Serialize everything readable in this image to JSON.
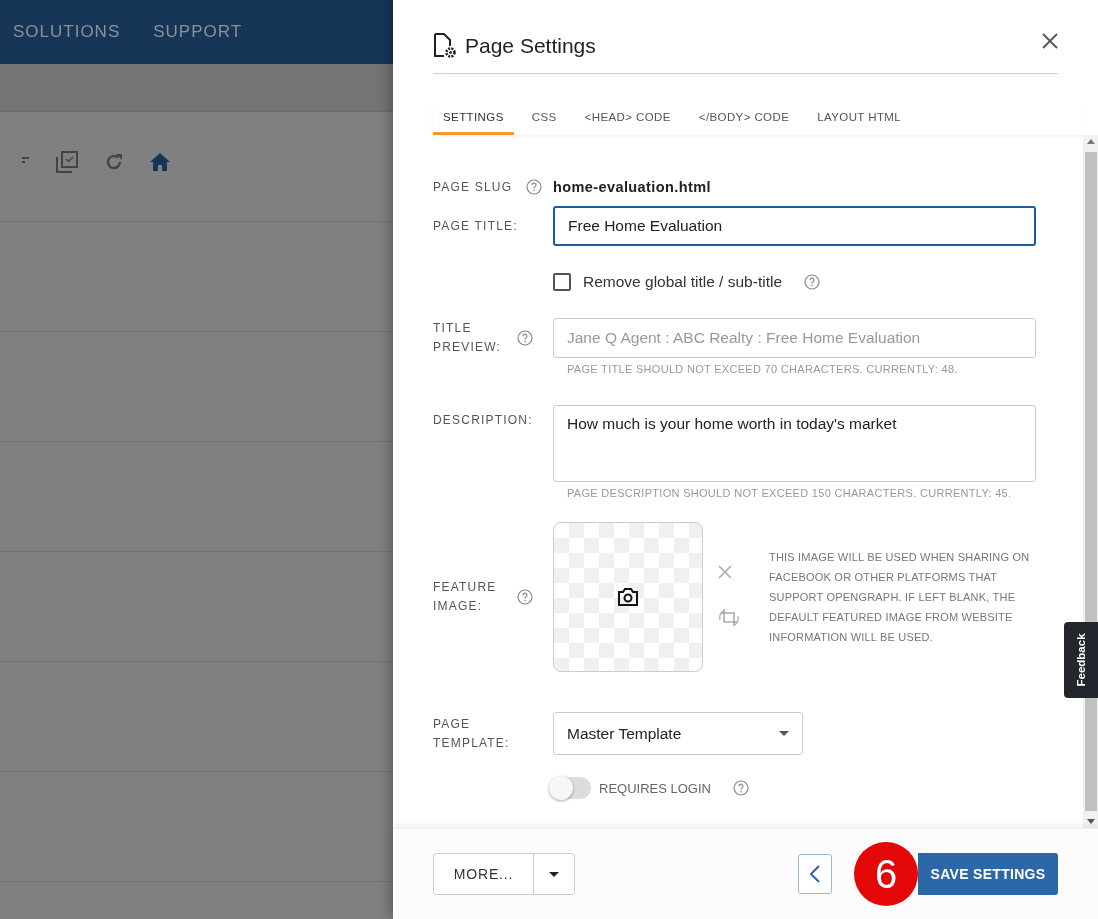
{
  "top_nav": {
    "items": [
      "SOLUTIONS",
      "SUPPORT"
    ]
  },
  "panel": {
    "title": "Page Settings",
    "tabs": [
      {
        "label": "SETTINGS",
        "selected": true
      },
      {
        "label": "CSS",
        "selected": false
      },
      {
        "label": "<HEAD> CODE",
        "selected": false
      },
      {
        "label": "</BODY> CODE",
        "selected": false
      },
      {
        "label": "LAYOUT HTML",
        "selected": false
      }
    ],
    "page_slug": {
      "label": "PAGE SLUG",
      "value": "home-evaluation.html"
    },
    "page_title": {
      "label": "PAGE TITLE:",
      "value": "Free Home Evaluation"
    },
    "remove_title": {
      "label": "Remove global title / sub-title",
      "checked": false
    },
    "title_preview": {
      "label": "TITLE PREVIEW:",
      "placeholder": "Jane Q Agent : ABC Realty : Free Home Evaluation",
      "hint": "PAGE TITLE SHOULD NOT EXCEED 70 CHARACTERS. CURRENTLY: 48."
    },
    "description": {
      "label": "DESCRIPTION:",
      "value": "How much is your home worth in today's market",
      "hint": "PAGE DESCRIPTION SHOULD NOT EXCEED 150 CHARACTERS. CURRENTLY: 45."
    },
    "feature_image": {
      "label": "FEATURE IMAGE:",
      "note": "THIS IMAGE WILL BE USED WHEN SHARING ON FACEBOOK OR OTHER PLATFORMS THAT SUPPORT OPENGRAPH. IF LEFT BLANK, THE DEFAULT FEATURED IMAGE FROM WEBSITE INFORMATION WILL BE USED."
    },
    "page_template": {
      "label": "PAGE TEMPLATE:",
      "value": "Master Template"
    },
    "requires_login": {
      "label": "REQUIRES LOGIN",
      "on": false
    },
    "more_button": "MORE...",
    "save_button": "SAVE SETTINGS",
    "step_badge": "6"
  },
  "feedback_tab": "Feedback"
}
